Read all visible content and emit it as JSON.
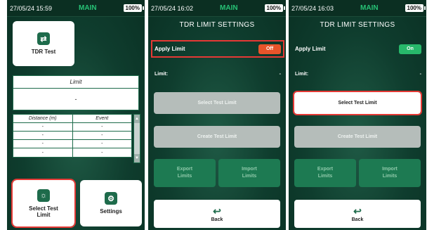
{
  "screens": [
    {
      "status": {
        "time": "27/05/24 15:59",
        "title": "MAIN",
        "battery": "100%"
      },
      "tdr_tile": {
        "label": "TDR Test",
        "icon": "cable-icon"
      },
      "limit_panel": {
        "header": "Limit",
        "value": "-"
      },
      "event_table": {
        "columns": [
          "Distance (m)",
          "Event"
        ],
        "rows": [
          [
            "-",
            "-"
          ],
          [
            "-",
            "-"
          ],
          [
            "-",
            "-"
          ],
          [
            "-",
            "-"
          ]
        ]
      },
      "select_limit_tile": {
        "label_line1": "Select Test",
        "label_line2": "Limit",
        "icon": "lightbulb-icon"
      },
      "settings_tile": {
        "label": "Settings",
        "icon": "gear-icon"
      }
    },
    {
      "status": {
        "time": "27/05/24 16:02",
        "title": "MAIN",
        "battery": "100%"
      },
      "page_title": "TDR LIMIT SETTINGS",
      "apply_limit": {
        "label": "Apply Limit",
        "state": "Off"
      },
      "limit": {
        "label": "Limit:",
        "value": "-"
      },
      "buttons": {
        "select": "Select Test Limit",
        "create": "Create Test Limit",
        "export_l1": "Export",
        "export_l2": "Limits",
        "import_l1": "Import",
        "import_l2": "Limits",
        "back": "Back"
      }
    },
    {
      "status": {
        "time": "27/05/24 16:03",
        "title": "MAIN",
        "battery": "100%"
      },
      "page_title": "TDR LIMIT SETTINGS",
      "apply_limit": {
        "label": "Apply Limit",
        "state": "On"
      },
      "limit": {
        "label": "Limit:",
        "value": "-"
      },
      "buttons": {
        "select": "Select Test Limit",
        "create": "Create Test Limit",
        "export_l1": "Export",
        "export_l2": "Limits",
        "import_l1": "Import",
        "import_l2": "Limits",
        "back": "Back"
      }
    }
  ],
  "colors": {
    "background": "#0f3d2e",
    "accent_green": "#27c276",
    "toggle_off": "#e8542a",
    "toggle_on": "#27b86a",
    "highlight": "#e53935"
  }
}
